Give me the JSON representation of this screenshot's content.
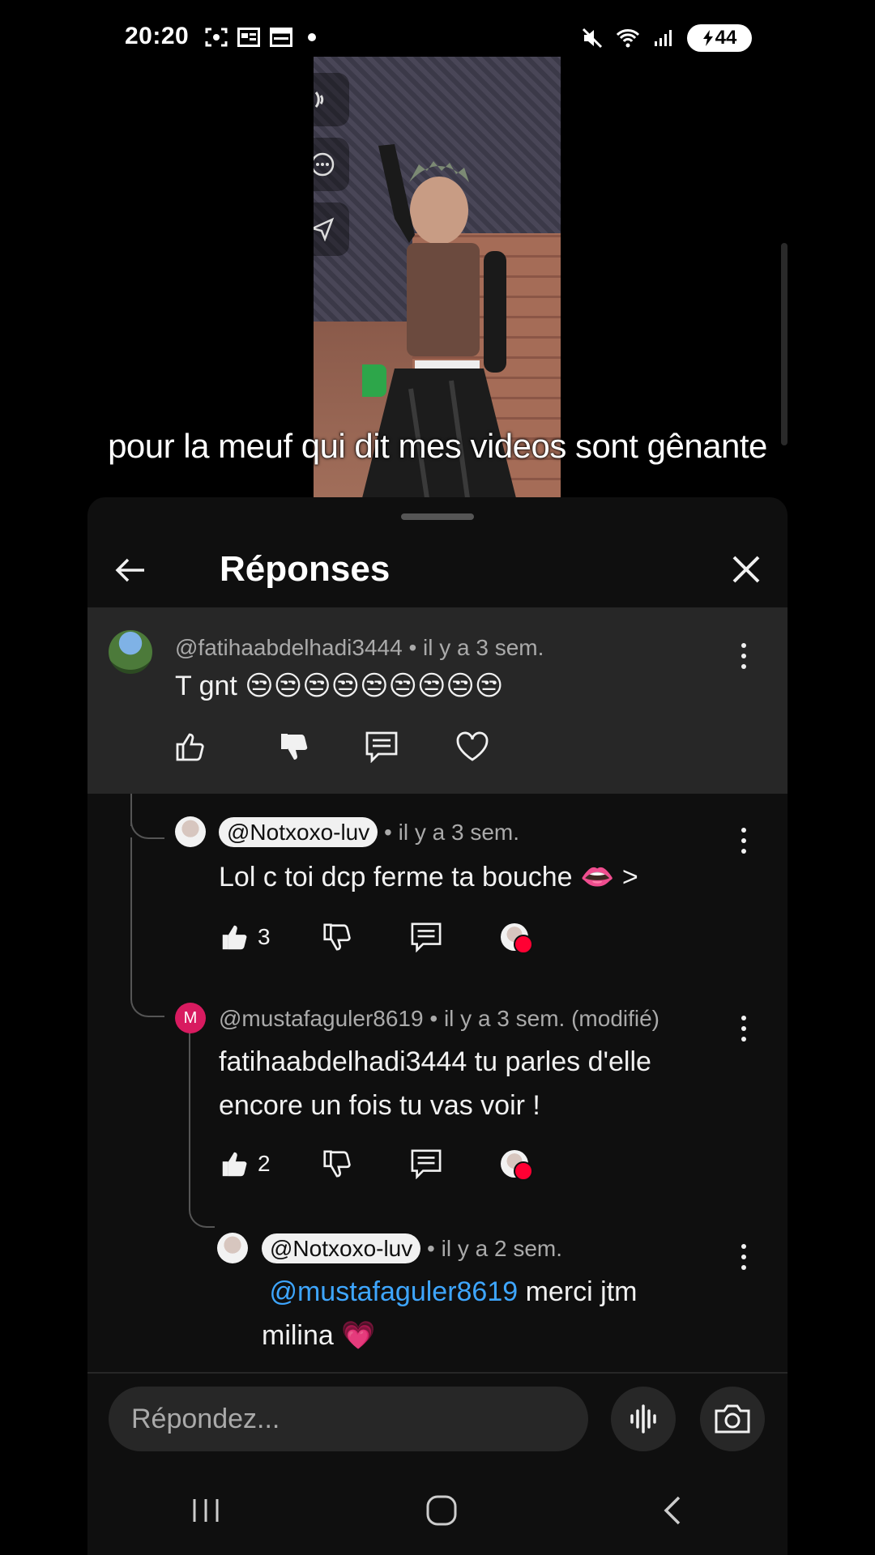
{
  "status_bar": {
    "time": "20:20",
    "battery": "44",
    "icons_left": [
      "screenshot-icon",
      "news-icon",
      "calendar-icon",
      "dot"
    ],
    "icons_right": [
      "mute-icon",
      "wifi-icon",
      "signal-icon",
      "battery-icon"
    ]
  },
  "video": {
    "caption": "pour la meuf qui dit mes videos sont gênante"
  },
  "panel": {
    "title": "Réponses",
    "parent_comment": {
      "author": "@fatihaabdelhadi3444",
      "time": "• il y a 3 sem.",
      "text": "T gnt 😒😒😒😒😒😒😒😒😒"
    },
    "replies": [
      {
        "author": "@Notxoxo-luv",
        "time": "• il y a 3 sem.",
        "text": "Lol c toi dcp ferme ta bouche 👄 >",
        "likes": "3"
      },
      {
        "author": "@mustafaguler8619",
        "avatar_letter": "M",
        "time": "• il y a 3 sem. (modifié)",
        "text_line1": "fatihaabdelhadi3444 tu parles d'elle",
        "text_line2": "encore un fois tu vas voir !",
        "likes": "2"
      },
      {
        "author": "@Notxoxo-luv",
        "time": "• il y a 2 sem.",
        "mention": "@mustafaguler8619",
        "text_after_mention": " merci jtm",
        "text_line2": "milina 💗"
      }
    ],
    "reply_placeholder": "Répondez..."
  },
  "colors": {
    "panel_bg": "#0f0f0f",
    "highlight_bg": "#272727",
    "mention": "#3ea6ff",
    "heart": "#ff0033"
  }
}
